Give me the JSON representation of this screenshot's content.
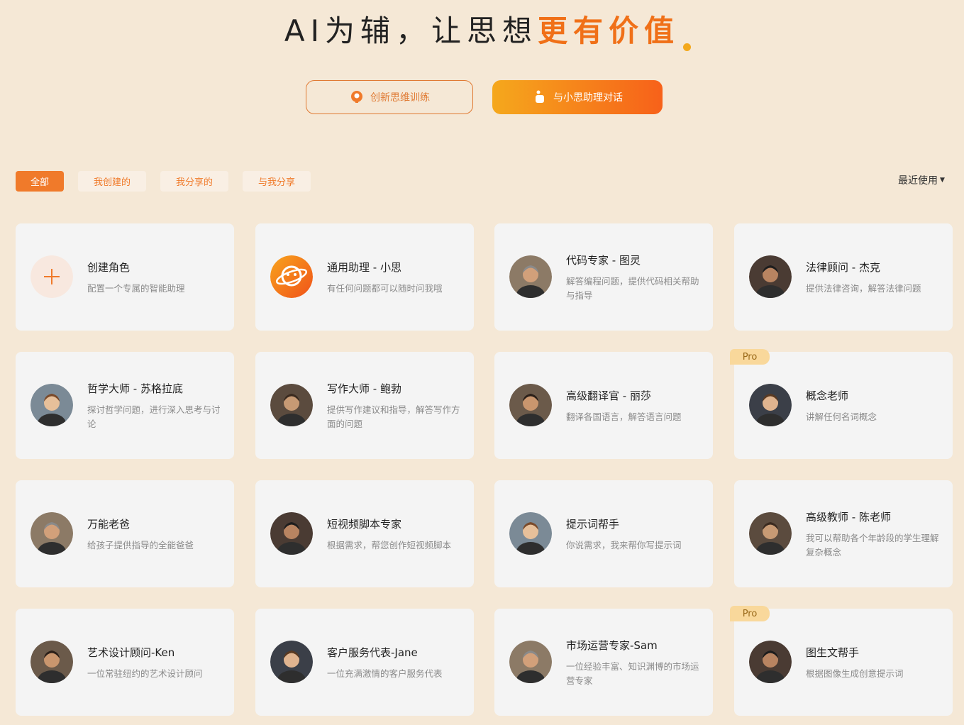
{
  "hero": {
    "title_plain": "AI为辅，让思想",
    "title_accent": "更有价值",
    "btn_training": "创新思维训练",
    "btn_chat": "与小思助理对话"
  },
  "tabs": [
    "全部",
    "我创建的",
    "我分享的",
    "与我分享"
  ],
  "sort_label": "最近使用",
  "colors": {
    "accent": "#f07a2a",
    "background": "#f5e8d6",
    "card": "#f4f4f4"
  },
  "cards": [
    {
      "title": "创建角色",
      "desc": "配置一个专属的智能助理",
      "icon": "plus-icon"
    },
    {
      "title": "通用助理 - 小思",
      "desc": "有任何问题都可以随时问我哦",
      "icon": "assistant-logo-icon"
    },
    {
      "title": "代码专家 - 图灵",
      "desc": "解答编程问题，提供代码相关帮助与指导",
      "icon": "avatar-portrait"
    },
    {
      "title": "法律顾问 - 杰克",
      "desc": "提供法律咨询，解答法律问题",
      "icon": "avatar-portrait"
    },
    {
      "title": "哲学大师 - 苏格拉底",
      "desc": "探讨哲学问题，进行深入思考与讨论",
      "icon": "avatar-portrait"
    },
    {
      "title": "写作大师 - 鲍勃",
      "desc": "提供写作建议和指导，解答写作方面的问题",
      "icon": "avatar-portrait"
    },
    {
      "title": "高级翻译官 - 丽莎",
      "desc": "翻译各国语言，解答语言问题",
      "icon": "avatar-portrait"
    },
    {
      "title": "概念老师",
      "desc": "讲解任何名词概念",
      "icon": "avatar-portrait",
      "badge": "Pro"
    },
    {
      "title": "万能老爸",
      "desc": "给孩子提供指导的全能爸爸",
      "icon": "avatar-portrait"
    },
    {
      "title": "短视频脚本专家",
      "desc": "根据需求，帮您创作短视频脚本",
      "icon": "avatar-portrait"
    },
    {
      "title": "提示词帮手",
      "desc": "你说需求，我来帮你写提示词",
      "icon": "avatar-portrait"
    },
    {
      "title": "高级教师 - 陈老师",
      "desc": "我可以帮助各个年龄段的学生理解复杂概念",
      "icon": "avatar-portrait"
    },
    {
      "title": "艺术设计顾问-Ken",
      "desc": "一位常驻纽约的艺术设计顾问",
      "icon": "avatar-portrait"
    },
    {
      "title": "客户服务代表-Jane",
      "desc": "一位充满激情的客户服务代表",
      "icon": "avatar-portrait"
    },
    {
      "title": "市场运营专家-Sam",
      "desc": "一位经验丰富、知识渊博的市场运营专家",
      "icon": "avatar-portrait"
    },
    {
      "title": "图生文帮手",
      "desc": "根据图像生成创意提示词",
      "icon": "avatar-portrait",
      "badge": "Pro"
    }
  ]
}
